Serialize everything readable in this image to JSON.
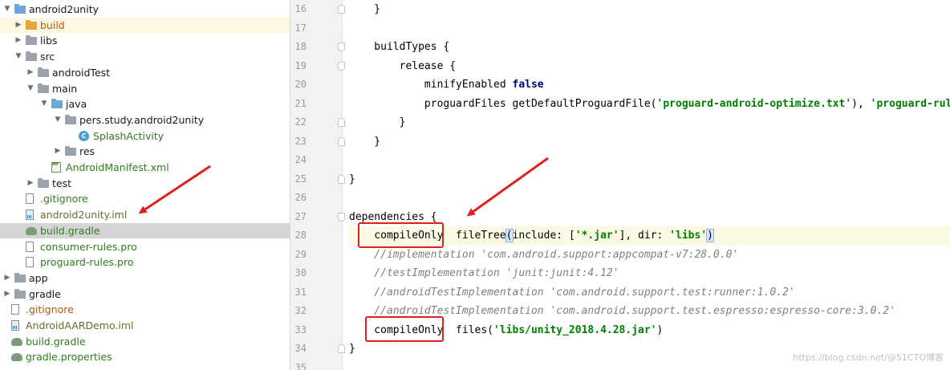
{
  "tree": {
    "items": [
      {
        "label": "android2unity",
        "icon": "module-folder-icon",
        "color": "dark",
        "arrow": "down"
      },
      {
        "label": "build",
        "icon": "folder-orange-icon",
        "color": "orange",
        "arrow": "right"
      },
      {
        "label": "libs",
        "icon": "folder-icon",
        "color": "dark",
        "arrow": "right"
      },
      {
        "label": "src",
        "icon": "folder-icon",
        "color": "dark",
        "arrow": "down"
      },
      {
        "label": "androidTest",
        "icon": "folder-icon",
        "color": "dark",
        "arrow": "right"
      },
      {
        "label": "main",
        "icon": "folder-icon",
        "color": "dark",
        "arrow": "down"
      },
      {
        "label": "java",
        "icon": "source-folder-icon",
        "color": "dark",
        "arrow": "down"
      },
      {
        "label": "pers.study.android2unity",
        "icon": "package-icon",
        "color": "dark",
        "arrow": "down"
      },
      {
        "label": "SplashActivity",
        "icon": "class-icon",
        "color": "green",
        "arrow": ""
      },
      {
        "label": "res",
        "icon": "resource-folder-icon",
        "color": "dark",
        "arrow": "right"
      },
      {
        "label": "AndroidManifest.xml",
        "icon": "manifest-file-icon",
        "color": "green",
        "arrow": ""
      },
      {
        "label": "test",
        "icon": "folder-icon",
        "color": "dark",
        "arrow": "right"
      },
      {
        "label": ".gitignore",
        "icon": "file-icon",
        "color": "green",
        "arrow": ""
      },
      {
        "label": "android2unity.iml",
        "icon": "iml-file-icon",
        "color": "olive",
        "arrow": ""
      },
      {
        "label": "build.gradle",
        "icon": "gradle-icon",
        "color": "green",
        "arrow": ""
      },
      {
        "label": "consumer-rules.pro",
        "icon": "file-icon",
        "color": "green",
        "arrow": ""
      },
      {
        "label": "proguard-rules.pro",
        "icon": "file-icon",
        "color": "green",
        "arrow": ""
      },
      {
        "label": "app",
        "icon": "folder-icon",
        "color": "dark",
        "arrow": "right"
      },
      {
        "label": "gradle",
        "icon": "folder-icon",
        "color": "dark",
        "arrow": "right"
      },
      {
        "label": ".gitignore",
        "icon": "file-icon",
        "color": "orange",
        "arrow": ""
      },
      {
        "label": "AndroidAARDemo.iml",
        "icon": "iml-file-icon",
        "color": "olive",
        "arrow": ""
      },
      {
        "label": "build.gradle",
        "icon": "gradle-icon",
        "color": "green",
        "arrow": ""
      },
      {
        "label": "gradle.properties",
        "icon": "gradle-icon",
        "color": "green",
        "arrow": ""
      }
    ]
  },
  "editor": {
    "lines": [
      {
        "n": "16",
        "tokens": [
          {
            "t": "    }",
            "c": ""
          }
        ],
        "fold": "up"
      },
      {
        "n": "17",
        "tokens": []
      },
      {
        "n": "18",
        "tokens": [
          {
            "t": "    buildTypes {",
            "c": ""
          }
        ],
        "fold": "down"
      },
      {
        "n": "19",
        "tokens": [
          {
            "t": "        release {",
            "c": ""
          }
        ],
        "fold": "down"
      },
      {
        "n": "20",
        "tokens": [
          {
            "t": "            minifyEnabled ",
            "c": ""
          },
          {
            "t": "false",
            "c": "kw"
          }
        ]
      },
      {
        "n": "21",
        "tokens": [
          {
            "t": "            proguardFiles getDefaultProguardFile(",
            "c": ""
          },
          {
            "t": "'proguard-android-optimize.txt'",
            "c": "str"
          },
          {
            "t": "), ",
            "c": ""
          },
          {
            "t": "'proguard-rules.pro'",
            "c": "str"
          }
        ]
      },
      {
        "n": "22",
        "tokens": [
          {
            "t": "        }",
            "c": ""
          }
        ],
        "fold": "up"
      },
      {
        "n": "23",
        "tokens": [
          {
            "t": "    }",
            "c": ""
          }
        ],
        "fold": "up"
      },
      {
        "n": "24",
        "tokens": []
      },
      {
        "n": "25",
        "tokens": [
          {
            "t": "}",
            "c": ""
          }
        ],
        "fold": "up"
      },
      {
        "n": "26",
        "tokens": []
      },
      {
        "n": "27",
        "tokens": [
          {
            "t": "dependencies {",
            "c": ""
          }
        ],
        "fold": "down"
      },
      {
        "n": "28",
        "tokens": [
          {
            "t": "    compileOnly  fileTree",
            "c": ""
          },
          {
            "t": "(",
            "c": "match"
          },
          {
            "t": "include: [",
            "c": ""
          },
          {
            "t": "'*.jar'",
            "c": "str"
          },
          {
            "t": "], dir: ",
            "c": ""
          },
          {
            "t": "'libs'",
            "c": "str"
          },
          {
            "t": ")",
            "c": "match"
          }
        ],
        "current": true
      },
      {
        "n": "29",
        "tokens": [
          {
            "t": "    //implementation 'com.android.support:appcompat-v7:28.0.0'",
            "c": "cmt"
          }
        ]
      },
      {
        "n": "30",
        "tokens": [
          {
            "t": "    //testImplementation 'junit:junit:4.12'",
            "c": "cmt"
          }
        ]
      },
      {
        "n": "31",
        "tokens": [
          {
            "t": "    //androidTestImplementation 'com.android.support.test:runner:1.0.2'",
            "c": "cmt"
          }
        ]
      },
      {
        "n": "32",
        "tokens": [
          {
            "t": "    //androidTestImplementation 'com.android.support.test.espresso:espresso-core:3.0.2'",
            "c": "cmt"
          }
        ]
      },
      {
        "n": "33",
        "tokens": [
          {
            "t": "    compileOnly  files(",
            "c": ""
          },
          {
            "t": "'libs/unity_2018.4.28.jar'",
            "c": "str"
          },
          {
            "t": ")",
            "c": ""
          }
        ]
      },
      {
        "n": "34",
        "tokens": [
          {
            "t": "}",
            "c": ""
          }
        ],
        "fold": "up"
      },
      {
        "n": "35",
        "tokens": []
      }
    ]
  },
  "watermark": "https://blog.csdn.net/@51CTO博客",
  "colors": {
    "annotation": "#e02020",
    "string": "#008000",
    "keyword": "#000080",
    "comment": "#808080"
  }
}
